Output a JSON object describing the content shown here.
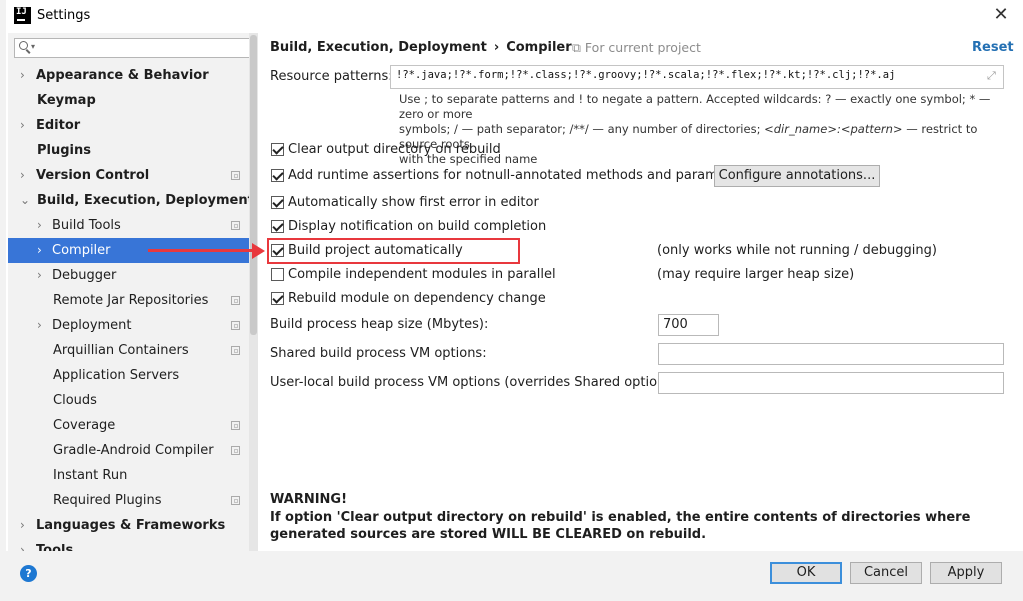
{
  "window": {
    "title": "Settings"
  },
  "sidebar": {
    "search_placeholder": "",
    "items": [
      {
        "label": "Appearance & Behavior"
      },
      {
        "label": "Keymap"
      },
      {
        "label": "Editor"
      },
      {
        "label": "Plugins"
      },
      {
        "label": "Version Control"
      },
      {
        "label": "Build, Execution, Deployment"
      },
      {
        "label": "Build Tools"
      },
      {
        "label": "Compiler"
      },
      {
        "label": "Debugger"
      },
      {
        "label": "Remote Jar Repositories"
      },
      {
        "label": "Deployment"
      },
      {
        "label": "Arquillian Containers"
      },
      {
        "label": "Application Servers"
      },
      {
        "label": "Clouds"
      },
      {
        "label": "Coverage"
      },
      {
        "label": "Gradle-Android Compiler"
      },
      {
        "label": "Instant Run"
      },
      {
        "label": "Required Plugins"
      },
      {
        "label": "Languages & Frameworks"
      },
      {
        "label": "Tools"
      }
    ]
  },
  "header": {
    "breadcrumb_parent": "Build, Execution, Deployment",
    "breadcrumb_separator": "›",
    "breadcrumb_current": "Compiler",
    "scope_label": "For current project",
    "reset_label": "Reset"
  },
  "resource": {
    "label": "Resource patterns:",
    "value": "!?*.java;!?*.form;!?*.class;!?*.groovy;!?*.scala;!?*.flex;!?*.kt;!?*.clj;!?*.aj",
    "help": {
      "l1": "Use ; to separate patterns and ! to negate a pattern. Accepted wildcards: ? — exactly one symbol; * — zero or more",
      "l2a": "symbols; / — path separator; /**/ — any number of directories; ",
      "l2b": "<dir_name>:<pattern>",
      "l2c": " — restrict to source roots",
      "l3": "with the specified name"
    }
  },
  "options": [
    {
      "label": "Clear output directory on rebuild",
      "checked": true
    },
    {
      "label": "Add runtime assertions for notnull-annotated methods and parameters",
      "checked": true
    },
    {
      "label": "Automatically show first error in editor",
      "checked": true
    },
    {
      "label": "Display notification on build completion",
      "checked": true
    },
    {
      "label": "Build project automatically",
      "checked": true,
      "note": "(only works while not running / debugging)"
    },
    {
      "label": "Compile independent modules in parallel",
      "checked": false,
      "note": "(may require larger heap size)"
    },
    {
      "label": "Rebuild module on dependency change",
      "checked": true
    }
  ],
  "configure_annotations_label": "Configure annotations...",
  "heap": {
    "label": "Build process heap size (Mbytes):",
    "value": "700"
  },
  "shared_vm": {
    "label": "Shared build process VM options:",
    "value": ""
  },
  "user_vm": {
    "label": "User-local build process VM options (overrides Shared options):",
    "value": ""
  },
  "warning": {
    "title": "WARNING!",
    "text": "If option 'Clear output directory on rebuild' is enabled, the entire contents of directories where generated sources are stored WILL BE CLEARED on rebuild."
  },
  "footer": {
    "help": "?",
    "ok": "OK",
    "cancel": "Cancel",
    "apply": "Apply"
  },
  "colors": {
    "selection": "#3875d7",
    "annotation": "#e8383d",
    "link": "#2470b3"
  }
}
